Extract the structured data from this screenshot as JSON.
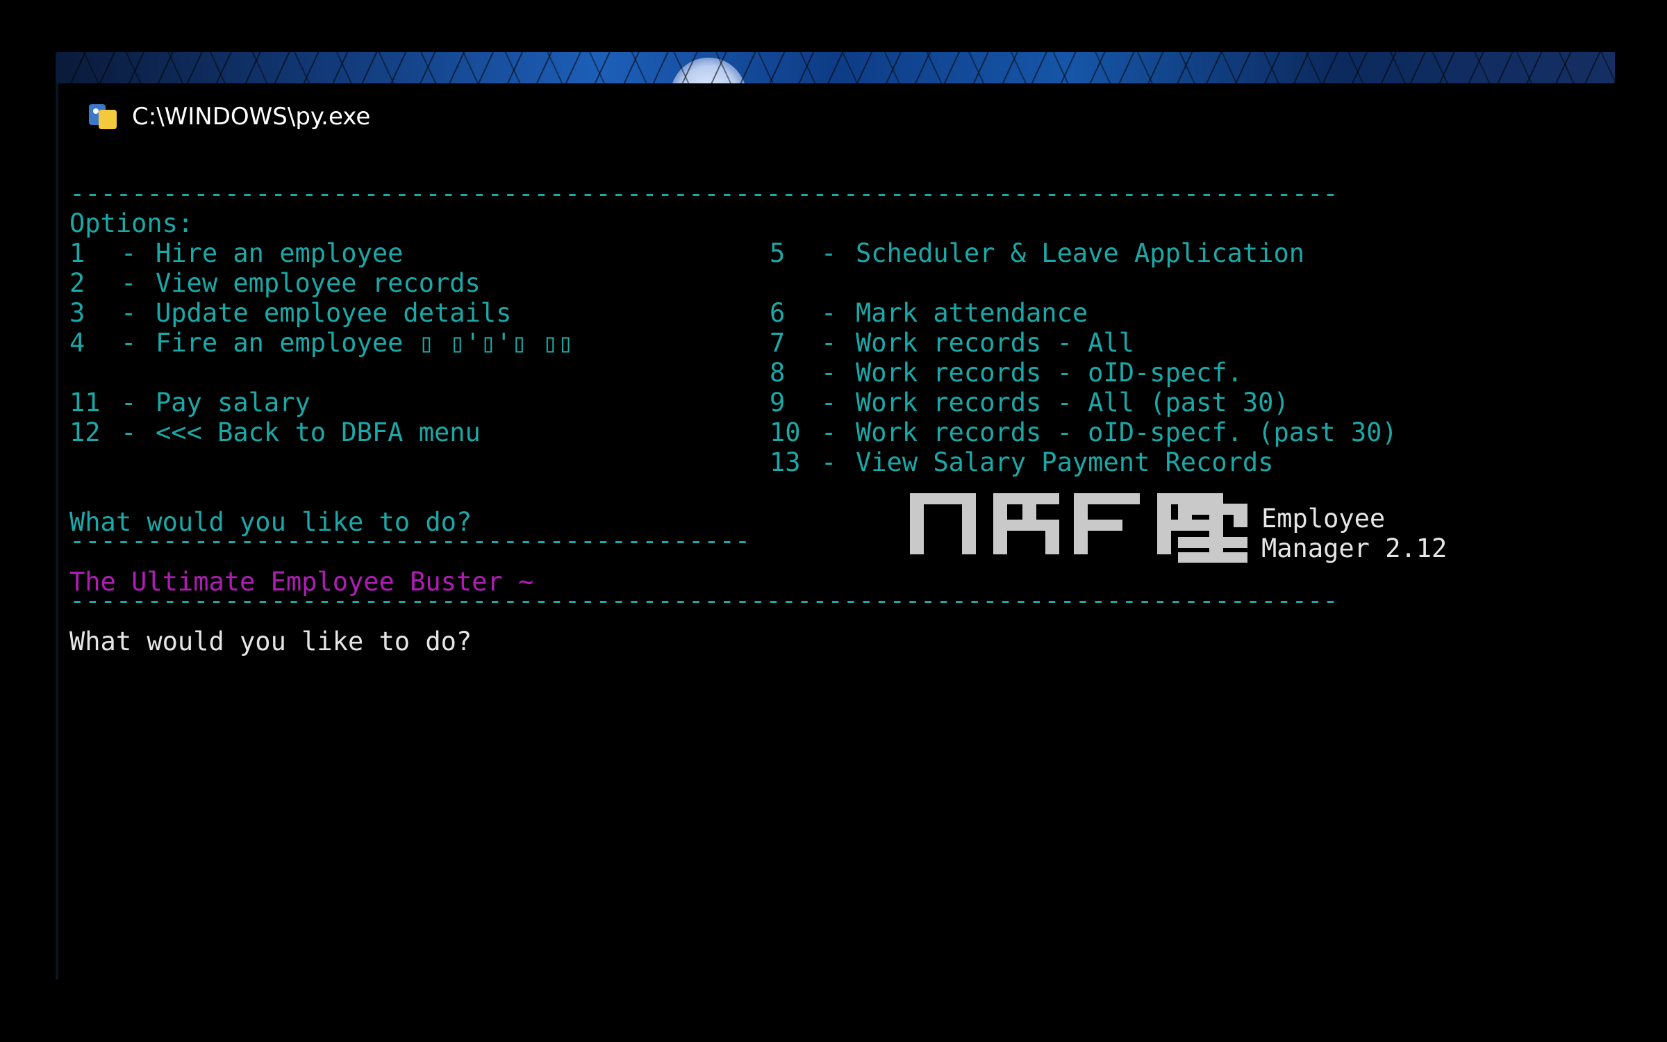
{
  "window": {
    "title": "C:\\WINDOWS\\py.exe",
    "icon": "python-launcher-icon"
  },
  "menu": {
    "rule": "----------------------------------------------------------------------------------",
    "heading": "Options:",
    "left": [
      {
        "num": "1",
        "label": "Hire an employee"
      },
      {
        "num": "2",
        "label": "View employee records"
      },
      {
        "num": "3",
        "label": "Update employee details"
      },
      {
        "num": "4",
        "label": "Fire an employee ▯ ▯'▯'▯ ▯▯"
      },
      {
        "num": "11",
        "label": "Pay salary"
      },
      {
        "num": "12",
        "label": "<<< Back to DBFA menu"
      }
    ],
    "right": [
      {
        "num": "5",
        "label": "Scheduler & Leave Application"
      },
      {
        "num": "6",
        "label": "Mark attendance"
      },
      {
        "num": "7",
        "label": "Work records - All"
      },
      {
        "num": "8",
        "label": "Work records - oID-specf."
      },
      {
        "num": "9",
        "label": "Work records - All (past 30)"
      },
      {
        "num": "10",
        "label": "Work records - oID-specf. (past 30)"
      },
      {
        "num": "13",
        "label": "View Salary Payment Records"
      }
    ],
    "prompt_teal": "What would you like to do?",
    "short_rule": "--------------------------------------------"
  },
  "banner": {
    "logo_text": "DBFA",
    "caption_line1": "Employee",
    "caption_line2": "Manager 2.12",
    "tagline": "The Ultimate Employee Buster ~"
  },
  "footer": {
    "rule": "----------------------------------------------------------------------------------",
    "prompt_white": "What would you like to do?"
  },
  "colors": {
    "teal": "#1aa9a8",
    "magenta": "#b11bb6",
    "white": "#e6e6e6",
    "background": "#000000"
  }
}
